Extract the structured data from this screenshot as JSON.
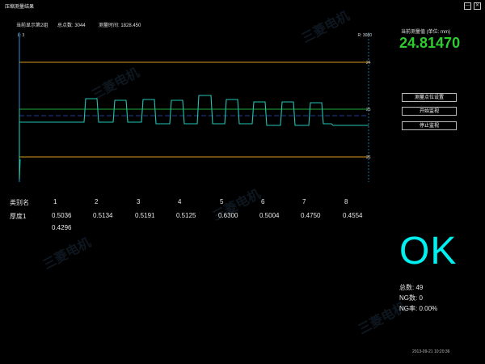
{
  "window": {
    "title": "压缩测量结果"
  },
  "window_controls": {
    "minimize": "—",
    "close": "✕"
  },
  "info_bar": {
    "current": "当前显示第2组",
    "points": "总点数: 3044",
    "time": "测量时间: 1828.450"
  },
  "plot": {
    "corner_left": "L: 3",
    "corner_right": "R: 3080",
    "y_tick_labels": [
      "24",
      "25",
      "26"
    ],
    "colors": {
      "signal": "#1fc4b4",
      "upper_limit": "#d79a1a",
      "nominal": "#1faa3a",
      "baseline": "#2a56c8",
      "axis": "#2a8fd0"
    }
  },
  "current_measure": {
    "label": "当前测量值 (单位: mm)",
    "value": "24.81470"
  },
  "buttons": {
    "settings": "测量点位设置",
    "start": "开始监视",
    "stop": "停止监视"
  },
  "table": {
    "row1_header": "类别名",
    "columns": [
      "1",
      "2",
      "3",
      "4",
      "5",
      "6",
      "7",
      "8"
    ],
    "row2_header": "厚度1",
    "values": [
      "0.5036",
      "0.5134",
      "0.5191",
      "0.5125",
      "0.6300",
      "0.5004",
      "0.4750",
      "0.4554"
    ],
    "wrapped_value": "0.4296"
  },
  "result": {
    "status": "OK"
  },
  "stats": {
    "total": "总数: 49",
    "ng_count": "NG数: 0",
    "ng_rate": "NG率: 0.00%"
  },
  "datetime": "2013-09-21  10:20:36",
  "watermark": "三菱电机"
}
